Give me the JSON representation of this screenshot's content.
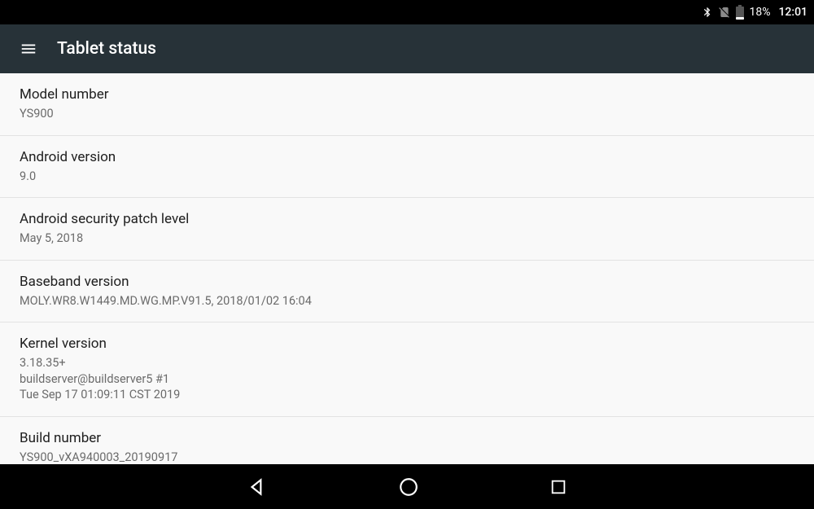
{
  "statusbar": {
    "battery_pct": "18%",
    "clock": "12:01"
  },
  "appbar": {
    "title": "Tablet status"
  },
  "items": [
    {
      "label": "Model number",
      "value": "YS900"
    },
    {
      "label": "Android version",
      "value": "9.0"
    },
    {
      "label": "Android security patch level",
      "value": "May 5, 2018"
    },
    {
      "label": "Baseband version",
      "value": "MOLY.WR8.W1449.MD.WG.MP.V91.5, 2018/01/02 16:04"
    },
    {
      "label": "Kernel version",
      "value": "3.18.35+\nbuildserver@buildserver5 #1\nTue Sep 17 01:09:11 CST 2019"
    },
    {
      "label": "Build number",
      "value": "YS900_vXA940003_20190917"
    }
  ]
}
